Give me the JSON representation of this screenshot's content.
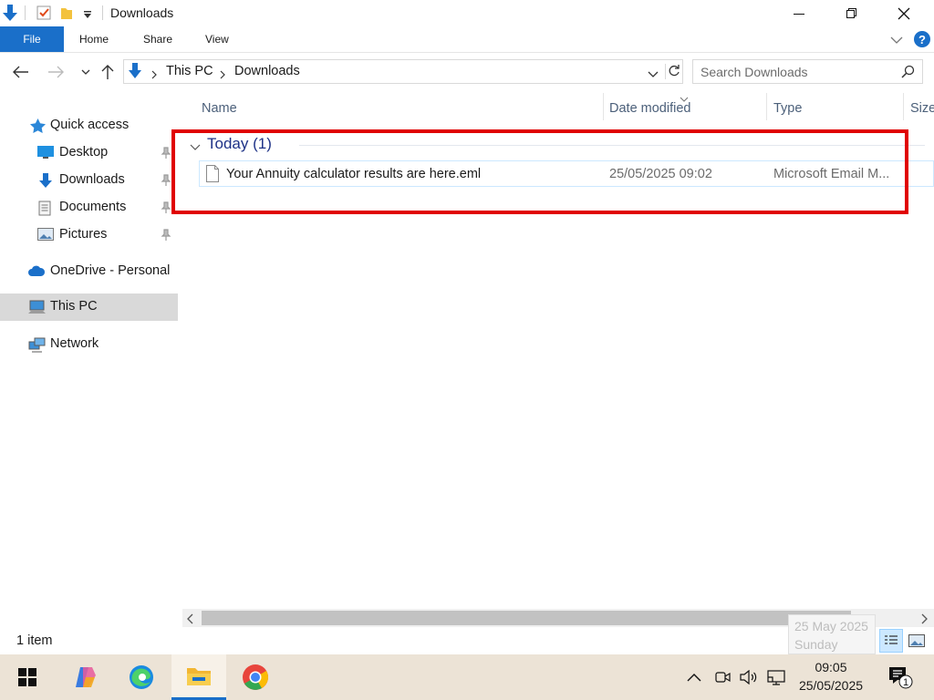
{
  "window": {
    "title": "Downloads"
  },
  "ribbon": {
    "tabs": [
      "File",
      "Home",
      "Share",
      "View"
    ]
  },
  "address": {
    "crumbs": [
      "This PC",
      "Downloads"
    ]
  },
  "search": {
    "placeholder": "Search Downloads"
  },
  "sidebar": {
    "items": [
      {
        "label": "Quick access",
        "icon": "star-icon"
      },
      {
        "label": "Desktop",
        "icon": "desktop-icon"
      },
      {
        "label": "Downloads",
        "icon": "download-arrow-icon"
      },
      {
        "label": "Documents",
        "icon": "documents-icon"
      },
      {
        "label": "Pictures",
        "icon": "pictures-icon"
      },
      {
        "label": "OneDrive - Personal",
        "icon": "cloud-icon"
      },
      {
        "label": "This PC",
        "icon": "computer-icon"
      },
      {
        "label": "Network",
        "icon": "network-icon"
      }
    ]
  },
  "columns": [
    "Name",
    "Date modified",
    "Type",
    "Size"
  ],
  "group": {
    "label": "Today (1)"
  },
  "files": [
    {
      "name": "Your Annuity calculator results are here.eml",
      "date": "25/05/2025 09:02",
      "type": "Microsoft Email M..."
    }
  ],
  "status": {
    "count": "1 item"
  },
  "tooltip": {
    "date": "25 May 2025",
    "day": "Sunday"
  },
  "taskbar": {
    "time": "09:05",
    "date": "25/05/2025",
    "notifications": "1"
  },
  "colors": {
    "accent": "#1a6fc9",
    "highlight": "#e00000",
    "group": "#1e3287"
  }
}
